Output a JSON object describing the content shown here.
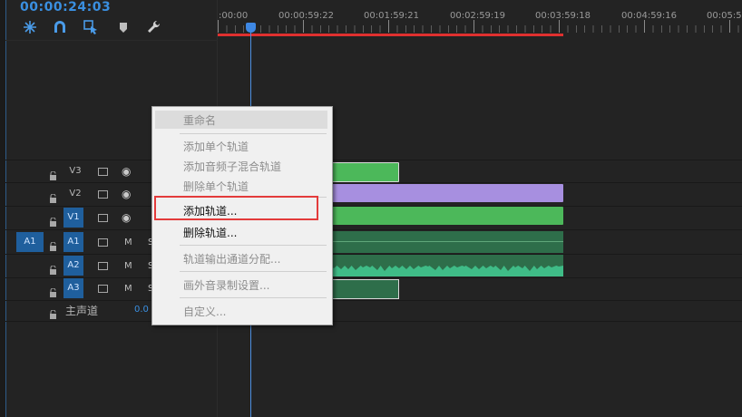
{
  "header": {
    "timecode": "00:00:24:03",
    "tools": [
      {
        "name": "snap-icon"
      },
      {
        "name": "magnet-icon"
      },
      {
        "name": "linked-selection-icon"
      },
      {
        "name": "marker-icon"
      },
      {
        "name": "wrench-icon"
      }
    ]
  },
  "ruler": {
    "labels": [
      ":00:00",
      "00:00:59:22",
      "00:01:59:21",
      "00:02:59:19",
      "00:03:59:18",
      "00:04:59:16",
      "00:05:5"
    ]
  },
  "tracks": {
    "video": [
      {
        "label": "V3",
        "source_on": false
      },
      {
        "label": "V2",
        "source_on": false
      },
      {
        "label": "V1",
        "source_on": true,
        "source_label": "V1"
      }
    ],
    "audio": [
      {
        "source_label": "A1",
        "label": "A1",
        "m": "M",
        "s": "S"
      },
      {
        "label": "A2",
        "m": "M",
        "s": "S"
      },
      {
        "label": "A3",
        "m": "M",
        "s": "S"
      }
    ],
    "master": {
      "label": "主声道",
      "value": "0.0"
    }
  },
  "colors": {
    "accent": "#3a8fe0",
    "video_clip_green": "#4cb85a",
    "video_clip_purple": "#a78fe0",
    "audio_clip": "#2e6e4a",
    "work_area": "#e0302f",
    "highlight": "#e33b3b"
  },
  "context_menu": {
    "items": [
      {
        "label": "重命名",
        "enabled": false
      },
      {
        "label": "添加单个轨道",
        "enabled": false
      },
      {
        "label": "添加音频子混合轨道",
        "enabled": false
      },
      {
        "label": "删除单个轨道",
        "enabled": false
      },
      {
        "label": "添加轨道...",
        "enabled": true,
        "highlighted": true
      },
      {
        "label": "删除轨道...",
        "enabled": true
      },
      {
        "label": "轨道输出通道分配...",
        "enabled": false
      },
      {
        "label": "画外音录制设置...",
        "enabled": false
      },
      {
        "label": "自定义...",
        "enabled": false
      }
    ]
  }
}
